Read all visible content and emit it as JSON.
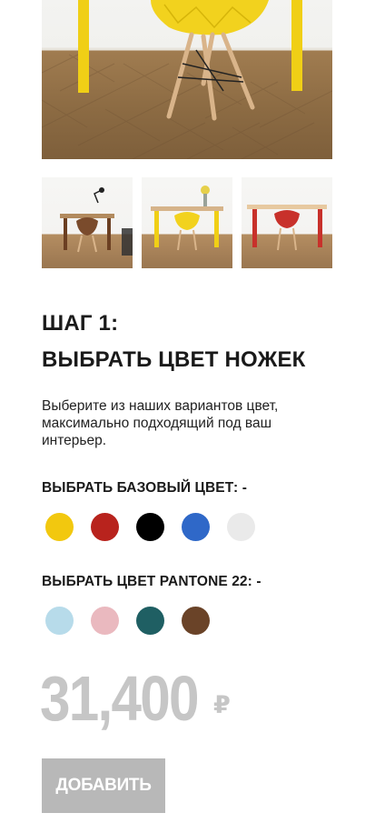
{
  "gallery": {
    "main_image": "yellow-leg-table-with-yellow-chair",
    "thumbnails": [
      {
        "name": "walnut-leg-table-with-brown-chair"
      },
      {
        "name": "yellow-leg-table-with-yellow-chair"
      },
      {
        "name": "red-leg-table-with-red-chair"
      }
    ]
  },
  "step": {
    "line1": "ШАГ 1:",
    "line2": "ВЫБРАТЬ ЦВЕТ НОЖЕК",
    "description": "Выберите из наших вариантов цвет, максимально подходящий под ваш интерьер."
  },
  "base_colors": {
    "label": "ВЫБРАТЬ БАЗОВЫЙ ЦВЕТ: -",
    "options": [
      {
        "name": "yellow",
        "color": "#f2c80f"
      },
      {
        "name": "red",
        "color": "#b8231d"
      },
      {
        "name": "black",
        "color": "#000000"
      },
      {
        "name": "blue",
        "color": "#2f68c8"
      },
      {
        "name": "light-grey",
        "color": "#eaeaea"
      }
    ]
  },
  "pantone_colors": {
    "label": "ВЫБРАТЬ ЦВЕТ PANTONE 22: -",
    "options": [
      {
        "name": "light-blue",
        "color": "#b7dbea"
      },
      {
        "name": "light-pink",
        "color": "#eab9bf"
      },
      {
        "name": "teal",
        "color": "#1f5f63"
      },
      {
        "name": "brown",
        "color": "#6a4328"
      }
    ]
  },
  "price": {
    "amount": "31,400",
    "currency": "₽"
  },
  "add_button": {
    "label": "ДОБАВИТЬ"
  },
  "colors": {
    "price_text": "#c6c6c6",
    "button_bg": "#b8b8b8",
    "button_text": "#ffffff"
  }
}
